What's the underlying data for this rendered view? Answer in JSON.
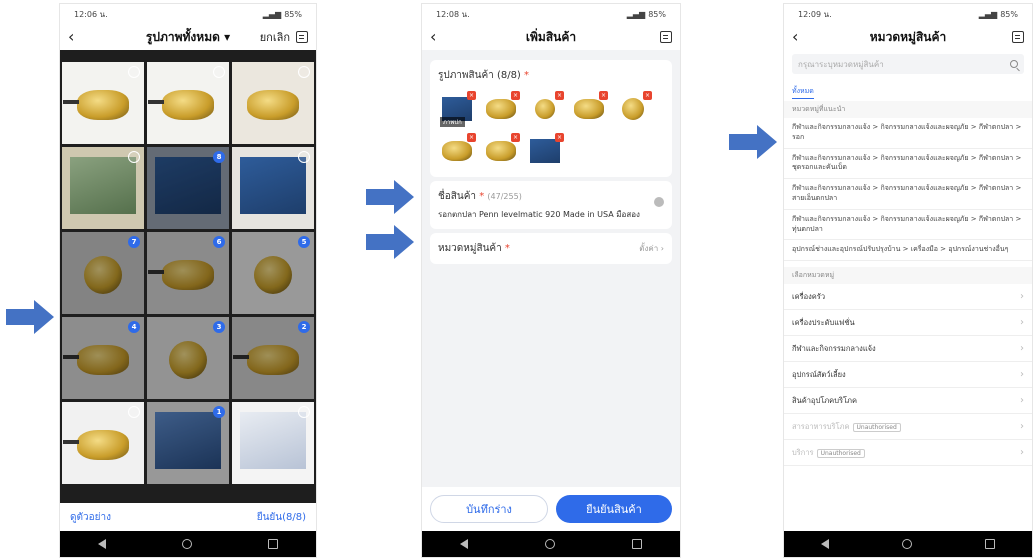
{
  "colors": {
    "accent": "#2f6be9",
    "arrow": "#4472c4",
    "required": "#e8442e"
  },
  "screen1": {
    "status_time": "12:06 น.",
    "battery": "85%",
    "title": "รูปภาพทั้งหมด ▾",
    "cancel": "ยกเลิก",
    "badges": [
      "",
      "",
      "",
      "",
      "8",
      "",
      "7",
      "6",
      "5",
      "4",
      "3",
      "2",
      "",
      "1",
      ""
    ],
    "preview": "ดูตัวอย่าง",
    "confirm": "ยืนยัน(8/8)"
  },
  "screen2": {
    "status_time": "12:08 น.",
    "battery": "85%",
    "title": "เพิ่มสินค้า",
    "images_label": "รูปภาพสินค้า (8/8)",
    "cover_label": "ภาพปก",
    "name_label": "ชื่อสินค้า",
    "name_count": "(47/255)",
    "name_value": "รอกตกปลา Penn levelmatic 920 Made in USA มือสอง",
    "category_label": "หมวดหมู่สินค้า",
    "category_placeholder": "ตั้งค่า",
    "save_draft": "บันทึกร่าง",
    "confirm_product": "ยืนยันสินค้า"
  },
  "screen3": {
    "status_time": "12:09 น.",
    "battery": "85%",
    "title": "หมวดหมู่สินค้า",
    "search_placeholder": "กรุณาระบุหมวดหมู่สินค้า",
    "tab_all": "ทั้งหมด",
    "suggest_header": "หมวดหมู่ที่แนะนำ",
    "suggestions": [
      "กีฬาและกิจกรรมกลางแจ้ง > กิจกรรมกลางแจ้งและผจญภัย > กีฬาตกปลา > รอก",
      "กีฬาและกิจกรรมกลางแจ้ง > กิจกรรมกลางแจ้งและผจญภัย > กีฬาตกปลา > ชุดรอกและคันเบ็ด",
      "กีฬาและกิจกรรมกลางแจ้ง > กิจกรรมกลางแจ้งและผจญภัย > กีฬาตกปลา > สายเอ็นตกปลา",
      "กีฬาและกิจกรรมกลางแจ้ง > กิจกรรมกลางแจ้งและผจญภัย > กีฬาตกปลา > ทุ่นตกปลา",
      "อุปกรณ์ช่างและอุปกรณ์ปรับปรุงบ้าน > เครื่องมือ > อุปกรณ์งานช่างอื่นๆ"
    ],
    "choose_header": "เลือกหมวดหมู่",
    "categories": [
      {
        "label": "เครื่องครัว",
        "tag": ""
      },
      {
        "label": "เครื่องประดับแฟชั่น",
        "tag": ""
      },
      {
        "label": "กีฬาและกิจกรรมกลางแจ้ง",
        "tag": ""
      },
      {
        "label": "อุปกรณ์สัตว์เลี้ยง",
        "tag": ""
      },
      {
        "label": "สินค้าอุปโภคบริโภค",
        "tag": ""
      },
      {
        "label": "สารอาหารบริโภค",
        "tag": "Unauthorised"
      },
      {
        "label": "บริการ",
        "tag": "Unauthorised"
      }
    ]
  }
}
